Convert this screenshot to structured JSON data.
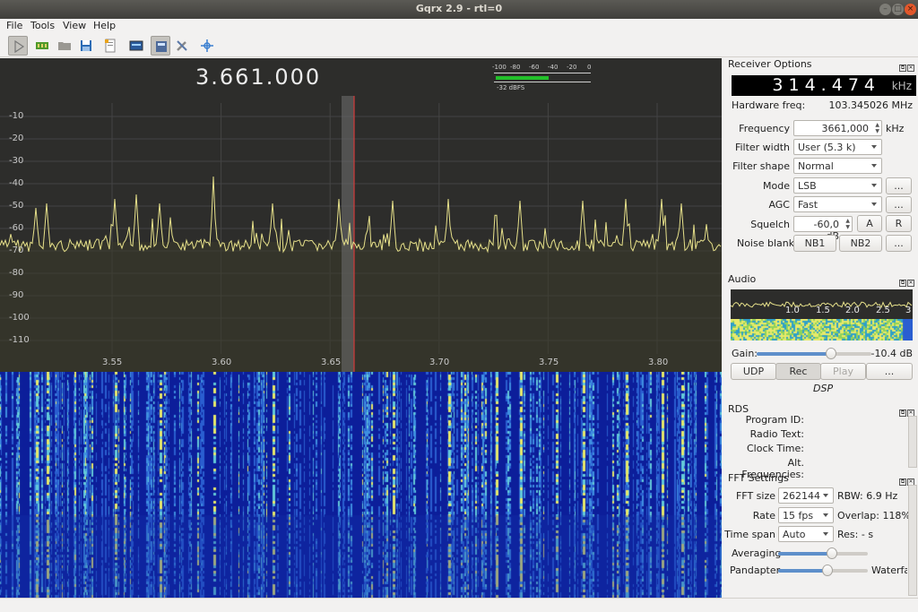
{
  "window": {
    "title": "Gqrx 2.9 - rtl=0"
  },
  "menu": [
    "File",
    "Tools",
    "View",
    "Help"
  ],
  "toolbar": [
    "play-icon",
    "device-icon",
    "open-icon",
    "save-icon",
    "file-icon",
    "display-icon",
    "remote-icon",
    "tools-icon",
    "center-icon"
  ],
  "plot": {
    "frequency": "3.661.000",
    "y_ticks": [
      "-10",
      "-20",
      "-30",
      "-40",
      "-50",
      "-60",
      "-70",
      "-80",
      "-90",
      "-100",
      "-110"
    ],
    "x_ticks": [
      "3.55",
      "3.60",
      "3.65",
      "3.70",
      "3.75",
      "3.80"
    ],
    "meter_ticks": [
      "-100",
      "-80",
      "-60",
      "-40",
      "-20",
      "0"
    ],
    "meter_level": 0.57,
    "meter_dbfs": "-32 dBFS"
  },
  "receiver": {
    "title": "Receiver Options",
    "lcd_value": "314.474",
    "lcd_unit": "kHz",
    "hw_label": "Hardware freq:",
    "hw_value": "103.345026 MHz",
    "frequency_label": "Frequency",
    "frequency_value": "3661,000",
    "frequency_unit": "kHz",
    "filter_width_label": "Filter width",
    "filter_width_value": "User (5.3 k)",
    "filter_shape_label": "Filter shape",
    "filter_shape_value": "Normal",
    "mode_label": "Mode",
    "mode_value": "LSB",
    "agc_label": "AGC",
    "agc_value": "Fast",
    "squelch_label": "Squelch",
    "squelch_value": "-60,0 dB",
    "squelch_a": "A",
    "squelch_r": "R",
    "nb_label": "Noise blanker",
    "nb1": "NB1",
    "nb2": "NB2",
    "more": "..."
  },
  "audio": {
    "title": "Audio",
    "ticks": [
      "1.0",
      "1.5",
      "2.0",
      "2.5",
      "3"
    ],
    "gain_label": "Gain:",
    "gain_value": "-10.4 dB",
    "gain_level": 0.65,
    "udp": "UDP",
    "rec": "Rec",
    "play": "Play",
    "more": "...",
    "dsp": "DSP"
  },
  "rds": {
    "title": "RDS",
    "program_id": "Program ID:",
    "radio_text": "Radio Text:",
    "clock_time": "Clock Time:",
    "alt_freq": "Alt. Frequencies:"
  },
  "fft": {
    "title": "FFT Settings",
    "size_label": "FFT size",
    "size_value": "262144",
    "rbw": "RBW: 6.9 Hz",
    "rate_label": "Rate",
    "rate_value": "15 fps",
    "overlap": "Overlap: 118%",
    "timespan_label": "Time span",
    "timespan_value": "Auto",
    "res": "Res: - s",
    "averaging_label": "Averaging",
    "averaging_level": 0.6,
    "pandapter_label": "Pandapter",
    "pandapter_level": 0.55,
    "waterfall_label": "Waterfa"
  }
}
